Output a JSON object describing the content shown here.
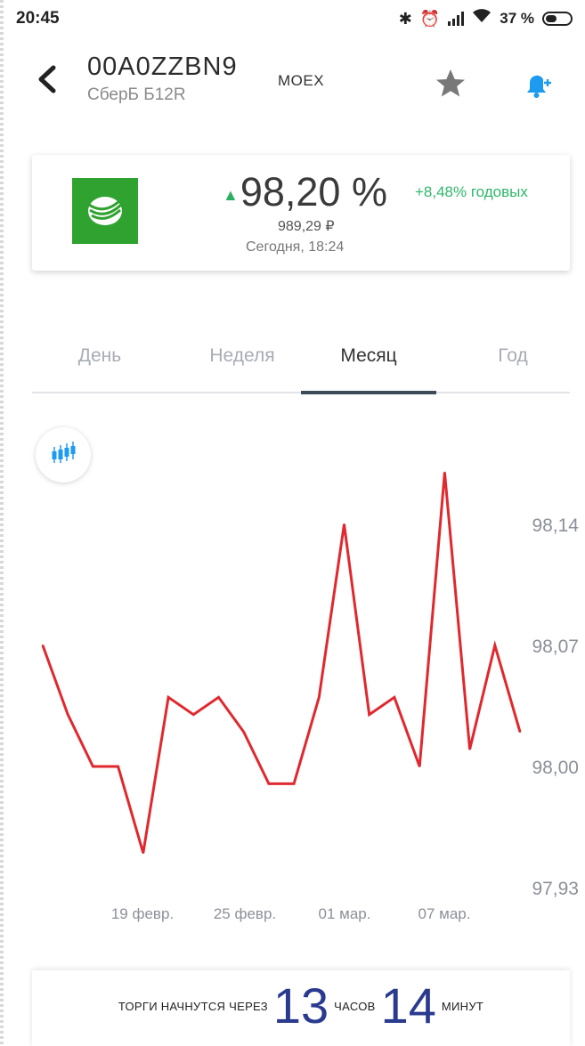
{
  "status_bar": {
    "time": "20:45",
    "battery": "37 %"
  },
  "header": {
    "ticker": "00A0ZZBN9",
    "name": "СберБ Б12R",
    "exchange": "MOEX"
  },
  "quote": {
    "price": "98,20 %",
    "yield": "+8,48% годовых",
    "price_rub": "989,29 ₽",
    "updated": "Сегодня, 18:24",
    "up_color": "#29b060"
  },
  "tabs": [
    {
      "label": "День"
    },
    {
      "label": "Неделя"
    },
    {
      "label": "Месяц",
      "active": true
    },
    {
      "label": "Год"
    }
  ],
  "chart_data": {
    "type": "line",
    "color": "#e0282e",
    "y_ticks": [
      "98,14",
      "98,07",
      "98,00",
      "97,93"
    ],
    "ylim": [
      97.93,
      98.14
    ],
    "x_tick_labels": [
      "19 февр.",
      "25 февр.",
      "01 мар.",
      "07 мар."
    ],
    "series": [
      {
        "values": [
          98.07,
          98.03,
          98.0,
          98.0,
          97.95,
          98.04,
          98.03,
          98.04,
          98.02,
          97.99,
          97.99,
          98.04,
          98.14,
          98.03,
          98.04,
          98.0,
          98.17,
          98.01,
          98.07,
          98.02
        ]
      }
    ],
    "grid": false,
    "legend": "none"
  },
  "banner": {
    "prefix": "ТОРГИ НАЧНУТСЯ ЧЕРЕЗ",
    "hours": "13",
    "hours_label": "ЧАСОВ",
    "minutes": "14",
    "minutes_label": "МИНУТ"
  }
}
